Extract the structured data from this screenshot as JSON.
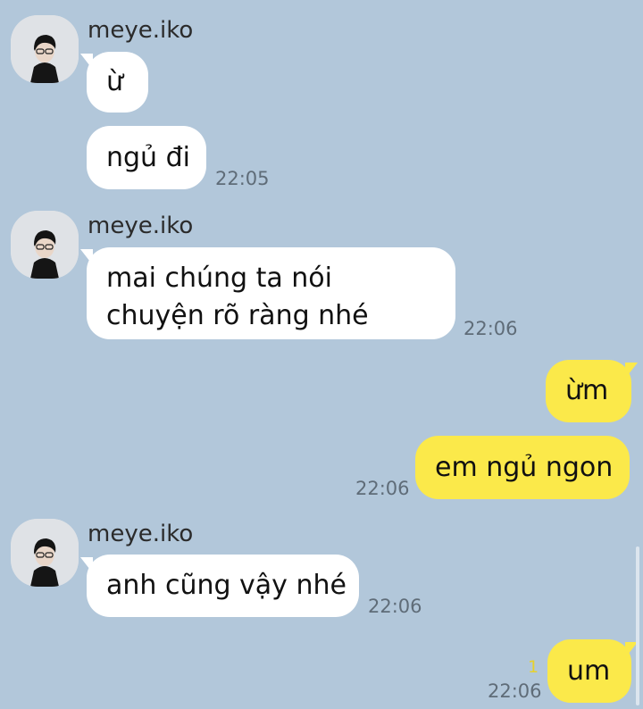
{
  "chat": {
    "groups": [
      {
        "sender": "meye.iko",
        "avatar_icon": "profile-photo-icon",
        "messages": [
          {
            "text": "ừ",
            "time": ""
          },
          {
            "text": "ngủ đi",
            "time": "22:05"
          }
        ]
      },
      {
        "sender": "meye.iko",
        "avatar_icon": "profile-photo-icon",
        "messages": [
          {
            "text": "mai chúng ta nói chuyện rõ ràng nhé",
            "time": "22:06"
          }
        ]
      },
      {
        "sender": "me",
        "messages": [
          {
            "text": "ừm",
            "time": ""
          },
          {
            "text": "em ngủ ngon",
            "time": "22:06"
          }
        ]
      },
      {
        "sender": "meye.iko",
        "avatar_icon": "profile-photo-icon",
        "messages": [
          {
            "text": "anh cũng vậy nhé",
            "time": "22:06"
          }
        ]
      },
      {
        "sender": "me",
        "messages": [
          {
            "text": "um",
            "time": "22:06",
            "unread_count": "1"
          }
        ]
      }
    ]
  },
  "colors": {
    "background": "#b2c7da",
    "incoming_bubble": "#ffffff",
    "outgoing_bubble": "#fbe94a",
    "timestamp": "#5f6c78",
    "unread_count": "#e7d12c"
  }
}
